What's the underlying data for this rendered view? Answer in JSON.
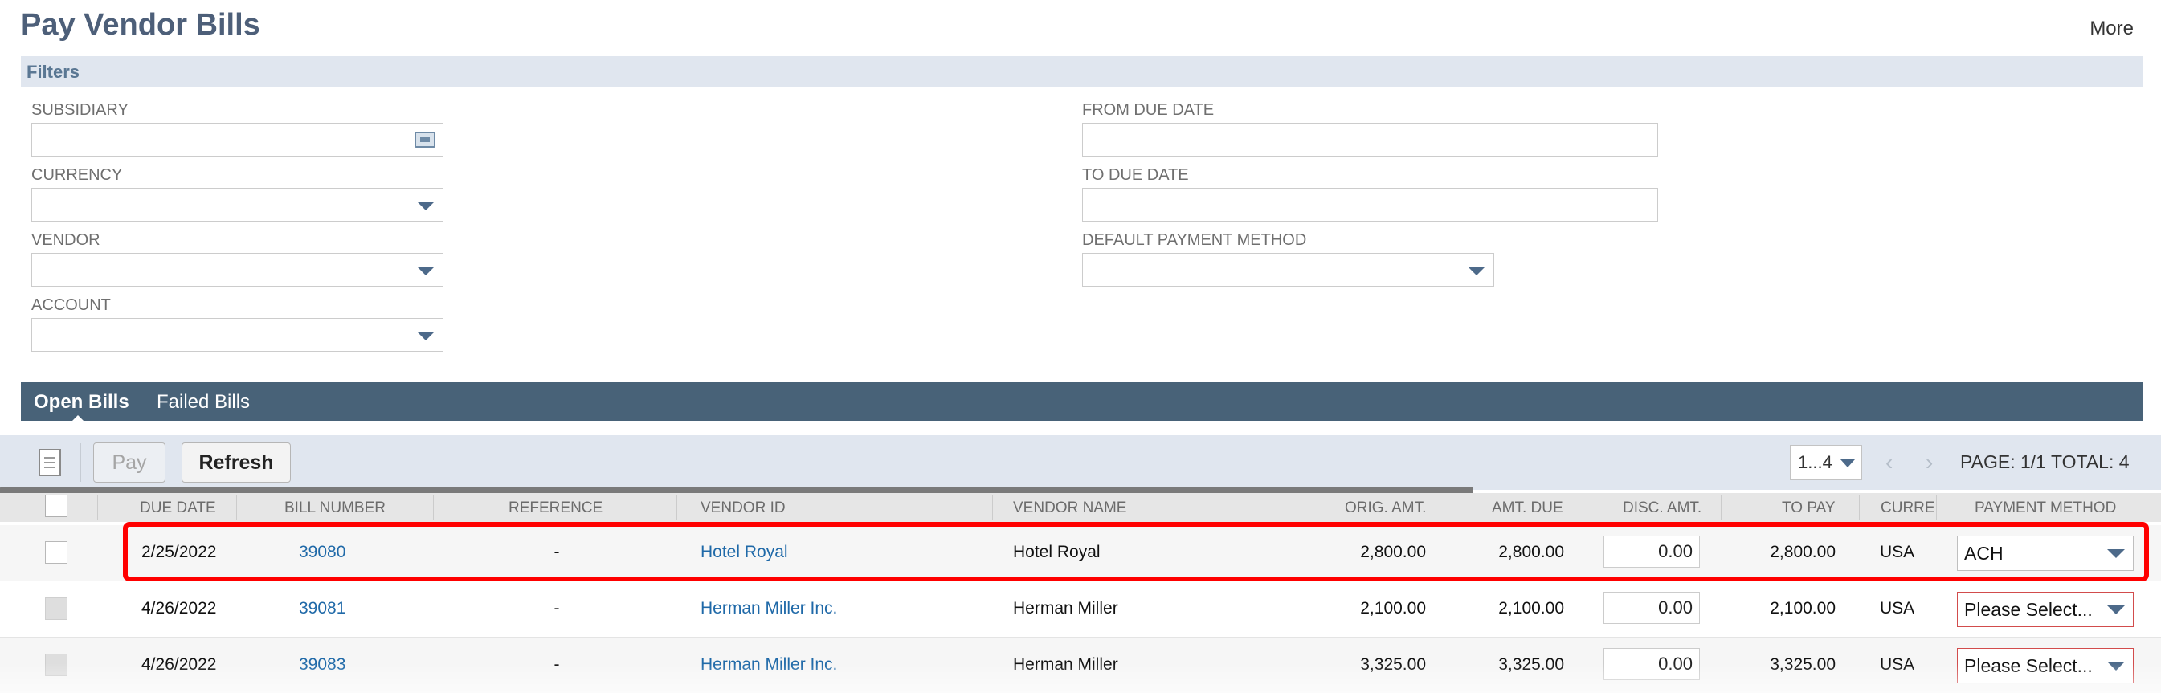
{
  "header": {
    "title": "Pay Vendor Bills",
    "more_label": "More"
  },
  "filters": {
    "title": "Filters",
    "subsidiary_label": "SUBSIDIARY",
    "currency_label": "CURRENCY",
    "vendor_label": "VENDOR",
    "account_label": "ACCOUNT",
    "from_due_date_label": "FROM DUE DATE",
    "to_due_date_label": "TO DUE DATE",
    "default_payment_method_label": "DEFAULT PAYMENT METHOD"
  },
  "tabs": [
    {
      "label": "Open Bills",
      "active": true
    },
    {
      "label": "Failed Bills",
      "active": false
    }
  ],
  "toolbar": {
    "pay_label": "Pay",
    "refresh_label": "Refresh",
    "page_range": "1...4",
    "page_info": "PAGE: 1/1",
    "total_info": "TOTAL: 4"
  },
  "table": {
    "columns": [
      "DUE DATE",
      "BILL NUMBER",
      "REFERENCE",
      "VENDOR ID",
      "VENDOR NAME",
      "ORIG. AMT.",
      "AMT. DUE",
      "DISC. AMT.",
      "TO PAY",
      "CURRE",
      "PAYMENT METHOD"
    ],
    "rows": [
      {
        "due_date": "2/25/2022",
        "bill_number": "39080",
        "reference": "-",
        "vendor_id": "Hotel Royal",
        "vendor_name": "Hotel Royal",
        "orig_amt": "2,800.00",
        "amt_due": "2,800.00",
        "disc_amt": "0.00",
        "to_pay": "2,800.00",
        "currency": "USA",
        "payment_method": "ACH"
      },
      {
        "due_date": "4/26/2022",
        "bill_number": "39081",
        "reference": "-",
        "vendor_id": "Herman Miller Inc.",
        "vendor_name": "Herman Miller",
        "orig_amt": "2,100.00",
        "amt_due": "2,100.00",
        "disc_amt": "0.00",
        "to_pay": "2,100.00",
        "currency": "USA",
        "payment_method": "Please Select..."
      },
      {
        "due_date": "4/26/2022",
        "bill_number": "39083",
        "reference": "-",
        "vendor_id": "Herman Miller Inc.",
        "vendor_name": "Herman Miller",
        "orig_amt": "3,325.00",
        "amt_due": "3,325.00",
        "disc_amt": "0.00",
        "to_pay": "3,325.00",
        "currency": "USA",
        "payment_method": "Please Select..."
      }
    ]
  },
  "colors": {
    "title": "#4d5f79",
    "tab_strip": "#486278",
    "toolbar_bg": "#e0e6ef",
    "link": "#1f69a8",
    "highlight": "#ff0000",
    "warning_border": "#d24c4c"
  },
  "icons": [
    "document-icon",
    "picker-icon",
    "chevron-down-icon",
    "chevron-left-icon",
    "chevron-right-icon"
  ]
}
